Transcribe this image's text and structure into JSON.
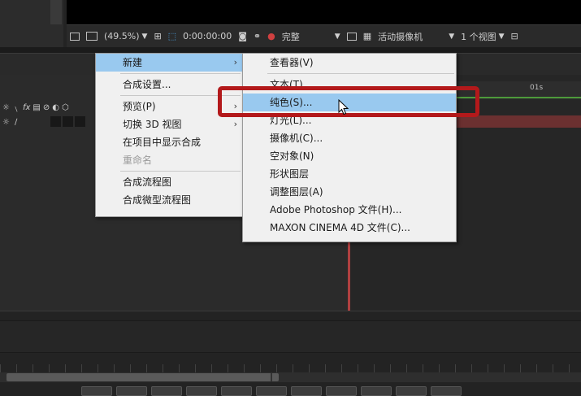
{
  "viewer_toolbar": {
    "zoom": "(49.5%)",
    "timecode": "0:00:00:00",
    "quality": "完整",
    "camera": "活动摄像机",
    "views": "1 个视图"
  },
  "timeline": {
    "ruler_label": "01s",
    "fx_label": "fx"
  },
  "context_menu": {
    "items": [
      {
        "label": "新建",
        "has_submenu": true,
        "highlighted": true
      },
      {
        "label": "合成设置...",
        "has_submenu": false
      },
      {
        "label": "预览(P)",
        "has_submenu": true
      },
      {
        "label": "切换 3D 视图",
        "has_submenu": true
      },
      {
        "label": "在项目中显示合成",
        "has_submenu": false
      },
      {
        "label": "重命名",
        "has_submenu": false,
        "disabled": true
      },
      {
        "label": "合成流程图",
        "has_submenu": false
      },
      {
        "label": "合成微型流程图",
        "has_submenu": false
      }
    ]
  },
  "submenu": {
    "items": [
      {
        "label": "查看器(V)"
      },
      {
        "label": "文本(T)"
      },
      {
        "label": "纯色(S)...",
        "highlighted": true
      },
      {
        "label": "灯光(L)..."
      },
      {
        "label": "摄像机(C)..."
      },
      {
        "label": "空对象(N)"
      },
      {
        "label": "形状图层"
      },
      {
        "label": "调整图层(A)"
      },
      {
        "label": "Adobe Photoshop 文件(H)..."
      },
      {
        "label": "MAXON CINEMA 4D 文件(C)..."
      }
    ]
  },
  "colors": {
    "menu_bg": "#f0f0f0",
    "menu_highlight": "#99c9ef",
    "annotation_red": "#b3191b"
  }
}
